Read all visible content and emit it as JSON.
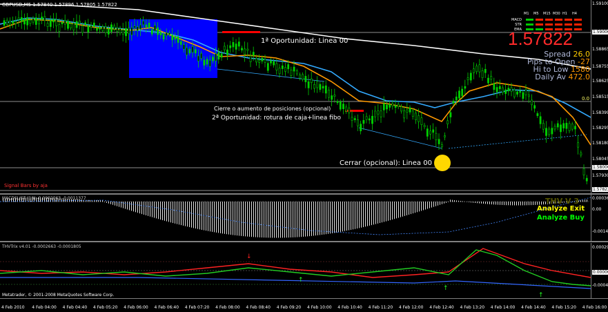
{
  "main_chart": {
    "symbol_header": "GBPUSD,M5  1.57840  1.57896  1.57805  1.57822",
    "annotations": {
      "opportunity1": "1ª Oportunidad: Linea 00",
      "close_or_increase": "Cierre o aumento de posiciones (opcional)",
      "opportunity2": "2ª Oportunidad: rotura de caja+linea fibo",
      "close_optional": "Cerrar (opcional): Linea 00",
      "fib_label": "0.0",
      "signal_bars_label": "Signal Bars by aja"
    },
    "signal_panel": {
      "timeframes": [
        "M1",
        "M5",
        "M15",
        "M30",
        "H1",
        "H4"
      ],
      "rows": [
        "MACD",
        "STR",
        "EMA"
      ],
      "price": "1.57822",
      "stats": [
        {
          "label": "Spread",
          "value": "26.0"
        },
        {
          "label": "Pips to Open",
          "value": "-27"
        },
        {
          "label": "Hi to Low",
          "value": "1580"
        },
        {
          "label": "Daily Av",
          "value": "472.0"
        }
      ]
    },
    "price_labels": [
      "1.59100",
      "1.59000",
      "1.58865",
      "1.58755",
      "1.58625",
      "1.58515",
      "1.58399",
      "1.58295",
      "1.58180",
      "1.58045",
      "1.58000",
      "1.57930",
      "1.57822"
    ],
    "colors": {
      "up": "#00d000",
      "box": "#0000ff",
      "sma": "#ffffff",
      "ema_fast": "#ff9900",
      "ema_slow": "#33aaff",
      "signal": "#ff0000",
      "marker": "#ffd700"
    }
  },
  "macd_pane": {
    "header": "MACDSLIST (18) -0.0002063 -0.0011377",
    "labels": [
      "THV V 3",
      "Analyze Exit",
      "Analyze Buy"
    ],
    "price_labels": [
      "0.00036",
      "0.00",
      "-0.00149"
    ]
  },
  "trix_pane": {
    "header": "THVTrix v4.01 -0.0002663 -0.0001805",
    "copyright": "Metatrader, © 2001-2008 MetaQuotes Software Corp.",
    "price_labels": [
      "0.00029",
      "0.00000",
      "-0.00044"
    ]
  },
  "time_axis": [
    "4 Feb 2010",
    "4 Feb 04:00",
    "4 Feb 04:40",
    "4 Feb 05:20",
    "4 Feb 06:00",
    "4 Feb 06:40",
    "4 Feb 07:20",
    "4 Feb 08:00",
    "4 Feb 08:40",
    "4 Feb 09:20",
    "4 Feb 10:00",
    "4 Feb 10:40",
    "4 Feb 11:20",
    "4 Feb 12:00",
    "4 Feb 12:40",
    "4 Feb 13:20",
    "4 Feb 14:00",
    "4 Feb 14:40",
    "4 Feb 15:20",
    "4 Feb 16:00"
  ]
}
